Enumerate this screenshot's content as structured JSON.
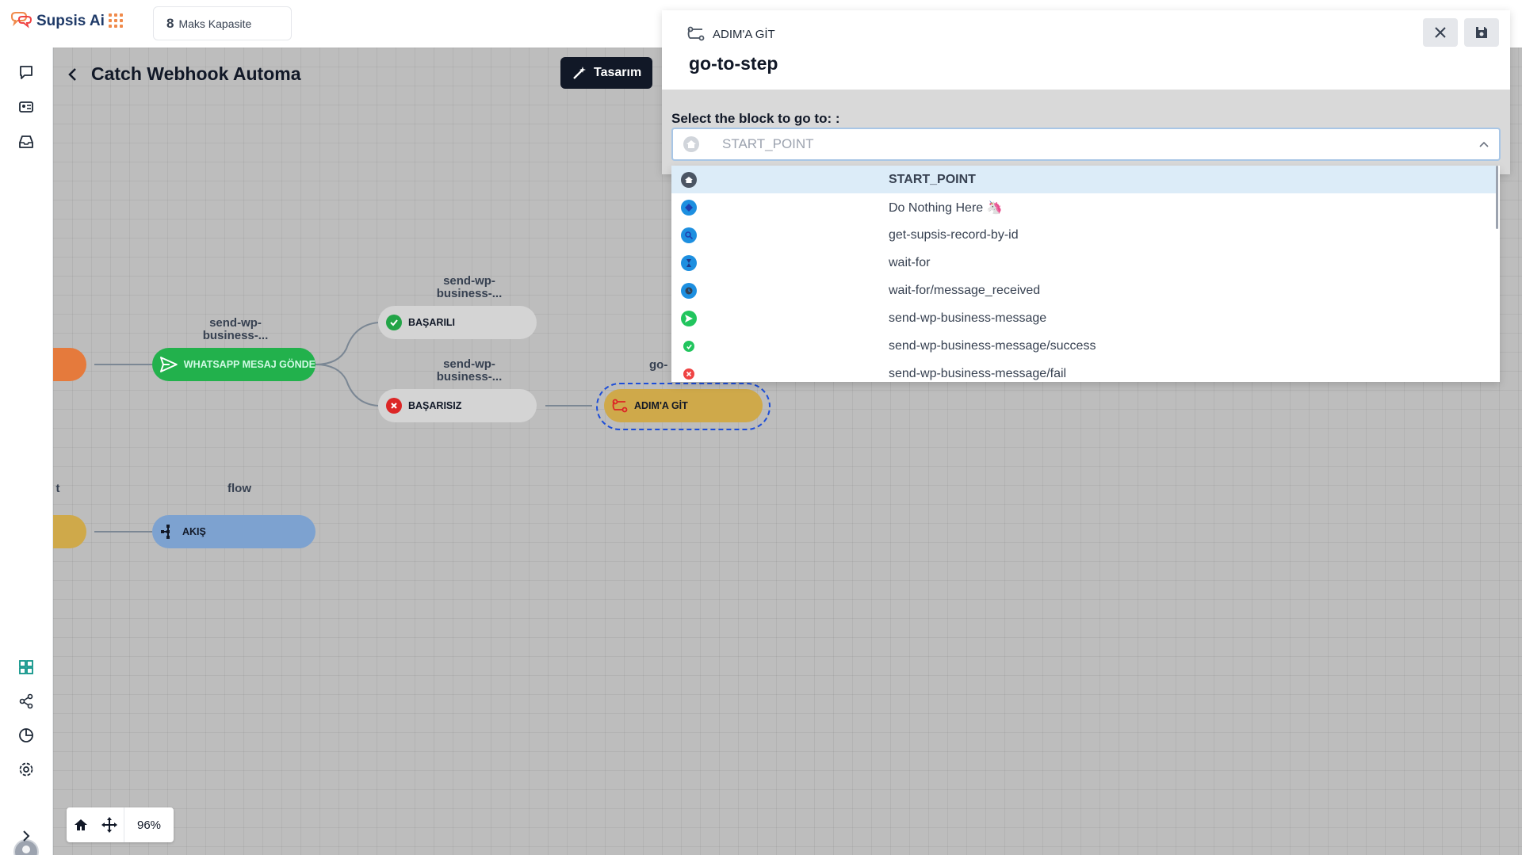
{
  "app": {
    "name": "Supsis Ai"
  },
  "capacity": {
    "number": "8",
    "label": "Maks Kapasite"
  },
  "flow": {
    "title": "Catch Webhook Automa",
    "design_button": "Tasarım"
  },
  "nodes": {
    "send_label_1": "send-wp-\nbusiness-...",
    "whatsapp": "WHATSAPP MESAJ GÖNDE",
    "success_label": "send-wp-\nbusiness-...",
    "success": "BAŞARILI",
    "fail_label": "send-wp-\nbusiness-...",
    "fail": "BAŞARISIZ",
    "goto_label": "go-",
    "goto": "ADIM'A GİT",
    "flow_label": "flow",
    "flow": "AKIŞ",
    "left_label": "t"
  },
  "zoom": {
    "percent": "96%"
  },
  "modal": {
    "type": "ADIM'A GİT",
    "name": "go-to-step",
    "field_label": "Select the block to go to: :",
    "selected_value": "START_POINT"
  },
  "dropdown": {
    "options": [
      {
        "label": "START_POINT",
        "icon": "home-icon",
        "color": "#4b5563"
      },
      {
        "label": "Do Nothing Here 🦄",
        "icon": "do-nothing-icon",
        "color": "#1d8fe0"
      },
      {
        "label": "get-supsis-record-by-id",
        "icon": "search-icon",
        "color": "#1d8fe0"
      },
      {
        "label": "wait-for",
        "icon": "hourglass-icon",
        "color": "#1d8fe0"
      },
      {
        "label": "wait-for/message_received",
        "icon": "clock-icon",
        "color": "#1d8fe0"
      },
      {
        "label": "send-wp-business-message",
        "icon": "send-icon",
        "color": "#22c55e"
      },
      {
        "label": "send-wp-business-message/success",
        "icon": "check-icon",
        "color": "#22c55e"
      },
      {
        "label": "send-wp-business-message/fail",
        "icon": "x-icon",
        "color": "#ef4444"
      }
    ]
  },
  "colors": {
    "brand": "#1f3a68",
    "accent_orange": "#f08a4b",
    "whatsapp_green": "#22c55e",
    "goto_yellow": "#cfa94a",
    "flow_blue": "#7da2d0"
  }
}
